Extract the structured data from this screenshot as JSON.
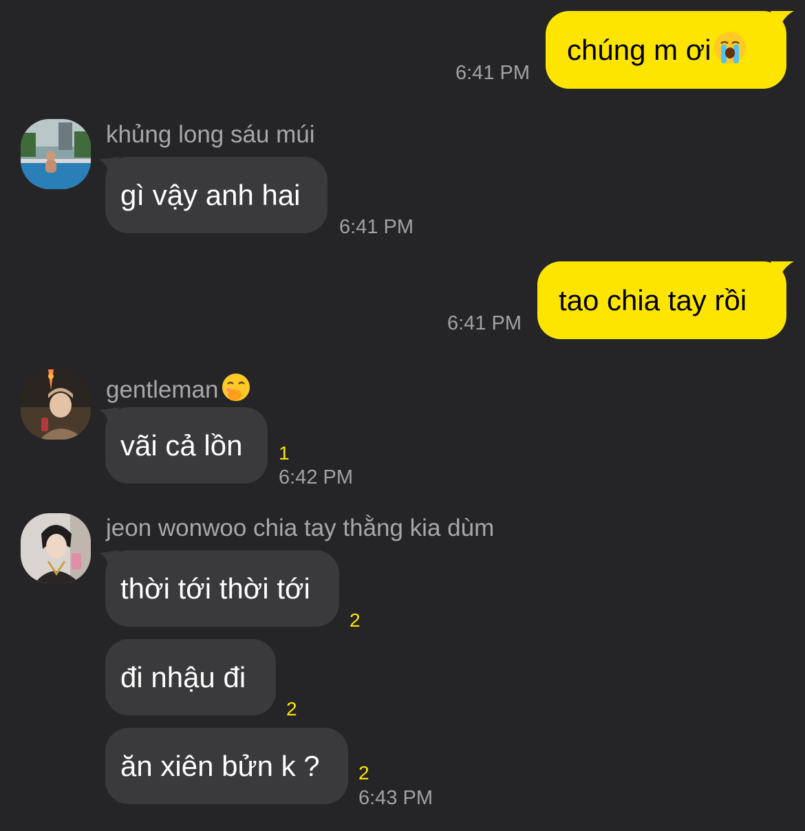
{
  "messages": [
    {
      "direction": "out",
      "text": "chúng m ơi",
      "emoji": "loudly-crying-face",
      "time": "6:41 PM"
    },
    {
      "direction": "in",
      "sender": "khủng long sáu múi",
      "avatar": "pool-photo-avatar",
      "text": "gì vậy anh hai",
      "time": "6:41 PM"
    },
    {
      "direction": "out",
      "text": "tao chia tay rồi",
      "time": "6:41 PM"
    },
    {
      "direction": "in",
      "sender": "gentleman",
      "sender_emoji": "face-with-hand-over-mouth",
      "avatar": "portrait-night-avatar",
      "text": "vãi cả lồn",
      "unread": "1",
      "time": "6:42 PM"
    },
    {
      "direction": "in",
      "sender": "jeon wonwoo chia tay thằng kia dùm",
      "avatar": "mirror-selfie-avatar",
      "texts": [
        "thời tới thời tới",
        "đi nhậu đi",
        "ăn xiên bửn k ?"
      ],
      "unreads": [
        "2",
        "2",
        "2"
      ],
      "time": "6:43 PM"
    }
  ],
  "colors": {
    "background": "#252527",
    "outgoing_bubble": "#fee500",
    "incoming_bubble": "#3a3a3c",
    "unread_count": "#fee500",
    "timestamp": "#a3a3a6"
  }
}
